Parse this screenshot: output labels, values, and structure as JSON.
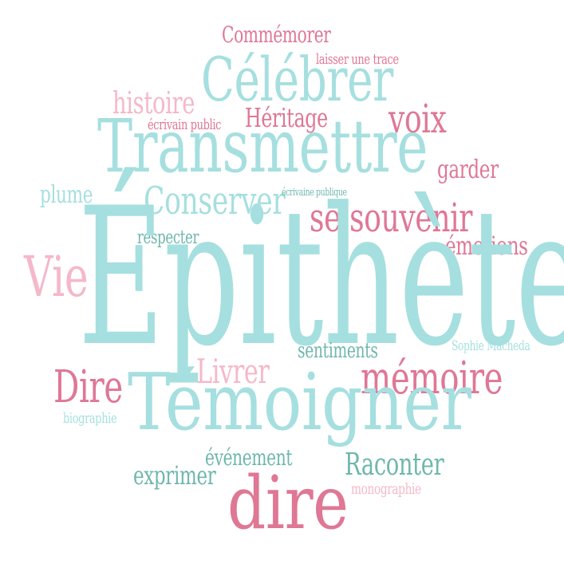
{
  "colors": {
    "teal": "#a6dfdf",
    "teal_dark": "#6fb7ad",
    "pink": "#df7795",
    "pink_light": "#f5b8c8"
  },
  "words": {
    "commemorer": "Commémorer",
    "laisser_une_trace": "laisser une trace",
    "celebrer": "Célébrer",
    "histoire": "histoire",
    "heritage": "Héritage",
    "voix": "voix",
    "ecrivain_public": "écrivain public",
    "transmettre": "Transmettre",
    "garder": "garder",
    "plume": "plume",
    "conserver": "Conserver",
    "ecrivaine_publique": "écrivaine publique",
    "se_souvenir": "se souvenir",
    "respecter": "respecter",
    "emotions": "émotions",
    "vie": "Vie",
    "epithete": "Épithète",
    "sentiments": "sentiments",
    "sophie_macheda": "Sophie Macheda",
    "livrer": "Livrer",
    "memoire": "mémoire",
    "dire_cap": "Dire",
    "temoigner": "Témoigner",
    "biographie": "biographie",
    "evenement": "événement",
    "raconter": "Raconter",
    "exprimer": "exprimer",
    "monographie": "monographie",
    "dire": "dire"
  }
}
